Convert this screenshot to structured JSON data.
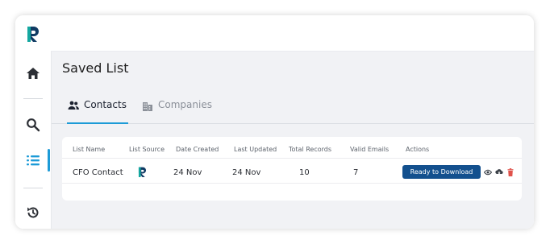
{
  "page": {
    "title": "Saved List"
  },
  "sidebar": {
    "items": [
      {
        "name": "home",
        "icon": "home-icon"
      },
      {
        "name": "search",
        "icon": "search-icon"
      },
      {
        "name": "lists",
        "icon": "list-icon",
        "active": true
      },
      {
        "name": "history",
        "icon": "history-icon"
      }
    ]
  },
  "tabs": [
    {
      "label": "Contacts",
      "icon": "users-icon",
      "active": true
    },
    {
      "label": "Companies",
      "icon": "building-icon",
      "active": false
    }
  ],
  "table": {
    "headers": [
      "List Name",
      "List Source",
      "Date Created",
      "Last Updated",
      "Total Records",
      "Valid Emails",
      "Actions"
    ],
    "rows": [
      {
        "list_name": "CFO Contact",
        "list_source_icon": "app-logo-icon",
        "date_created": "24 Nov",
        "last_updated": "24 Nov",
        "total_records": "10",
        "valid_emails": "7",
        "action_label": "Ready to Download"
      }
    ]
  },
  "colors": {
    "accent": "#1d9bd7",
    "primary_button": "#13508e",
    "delete": "#e0524b",
    "logo_dark": "#0f3a63",
    "logo_teal": "#14a7a0"
  }
}
